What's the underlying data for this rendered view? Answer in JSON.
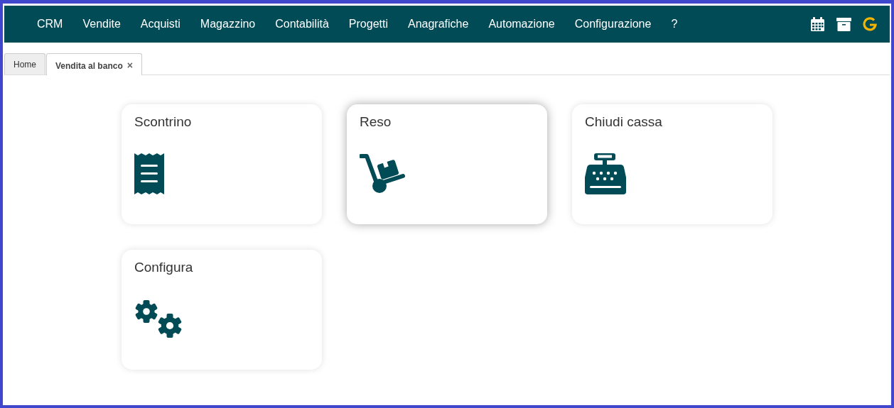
{
  "menu": [
    {
      "label": "CRM"
    },
    {
      "label": "Vendite"
    },
    {
      "label": "Acquisti"
    },
    {
      "label": "Magazzino"
    },
    {
      "label": "Contabilità"
    },
    {
      "label": "Progetti"
    },
    {
      "label": "Anagrafiche"
    },
    {
      "label": "Automazione"
    },
    {
      "label": "Configurazione"
    },
    {
      "label": "?"
    }
  ],
  "toolbar": [
    {
      "kind": "calendar"
    },
    {
      "kind": "archive"
    },
    {
      "kind": "google"
    }
  ],
  "tabs": [
    {
      "label": "Home",
      "selected": false
    },
    {
      "label": "Vendita al banco",
      "selected": true,
      "close": "×"
    }
  ],
  "tiles": [
    {
      "title": "Scontrino",
      "kind": "receipt",
      "hovered": false
    },
    {
      "title": "Reso",
      "kind": "trolley",
      "hovered": true
    },
    {
      "title": "Chiudi cassa",
      "kind": "register",
      "hovered": false
    },
    {
      "title": "Configura",
      "kind": "gears",
      "hovered": false
    }
  ]
}
